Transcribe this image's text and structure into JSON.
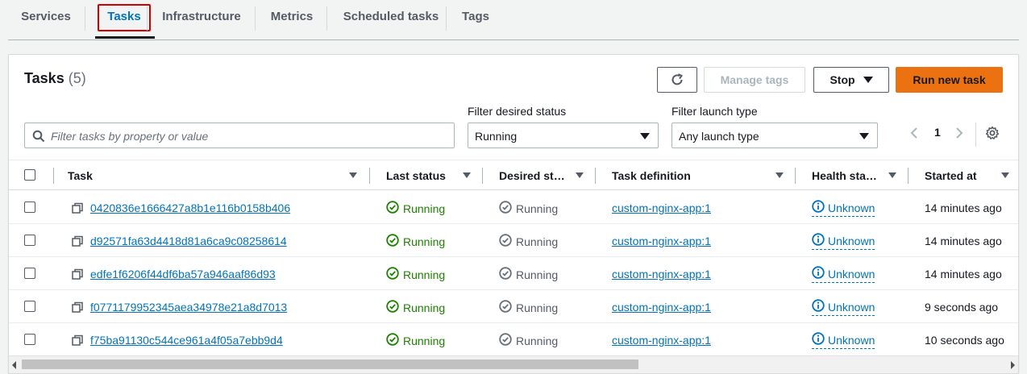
{
  "tabs": [
    {
      "label": "Services",
      "active": false
    },
    {
      "label": "Tasks",
      "active": true
    },
    {
      "label": "Infrastructure",
      "active": false
    },
    {
      "label": "Metrics",
      "active": false
    },
    {
      "label": "Scheduled tasks",
      "active": false
    },
    {
      "label": "Tags",
      "active": false
    }
  ],
  "panel": {
    "title": "Tasks",
    "count": "(5)",
    "refresh_icon": "refresh-icon",
    "manage_tags_label": "Manage tags",
    "stop_label": "Stop",
    "run_new_task_label": "Run new task",
    "search_placeholder": "Filter tasks by property or value",
    "filter_status_label": "Filter desired status",
    "filter_status_value": "Running",
    "filter_launch_label": "Filter launch type",
    "filter_launch_value": "Any launch type",
    "page_number": "1",
    "settings_icon": "gear-icon"
  },
  "table": {
    "columns": [
      "Task",
      "Last status",
      "Desired st…",
      "Task definition",
      "Health sta…",
      "Started at"
    ],
    "rows": [
      {
        "task": "0420836e1666427a8b1e116b0158b406",
        "last_status": "Running",
        "desired_status": "Running",
        "task_definition": "custom-nginx-app:1",
        "health": "Unknown",
        "started_at": "14 minutes ago"
      },
      {
        "task": "d92571fa63d4418d81a6ca9c08258614",
        "last_status": "Running",
        "desired_status": "Running",
        "task_definition": "custom-nginx-app:1",
        "health": "Unknown",
        "started_at": "14 minutes ago"
      },
      {
        "task": "edfe1f6206f44df6ba57a946aaf86d93",
        "last_status": "Running",
        "desired_status": "Running",
        "task_definition": "custom-nginx-app:1",
        "health": "Unknown",
        "started_at": "14 minutes ago"
      },
      {
        "task": "f0771179952345aea34978e21a8d7013",
        "last_status": "Running",
        "desired_status": "Running",
        "task_definition": "custom-nginx-app:1",
        "health": "Unknown",
        "started_at": "9 seconds ago"
      },
      {
        "task": "f75ba91130c544ce961a4f05a7ebb9d4",
        "last_status": "Running",
        "desired_status": "Running",
        "task_definition": "custom-nginx-app:1",
        "health": "Unknown",
        "started_at": "10 seconds ago"
      }
    ]
  },
  "colors": {
    "accent": "#0073bb",
    "primary_button": "#ec7211",
    "running_green": "#1d8102",
    "highlight_red": "#d10000"
  }
}
